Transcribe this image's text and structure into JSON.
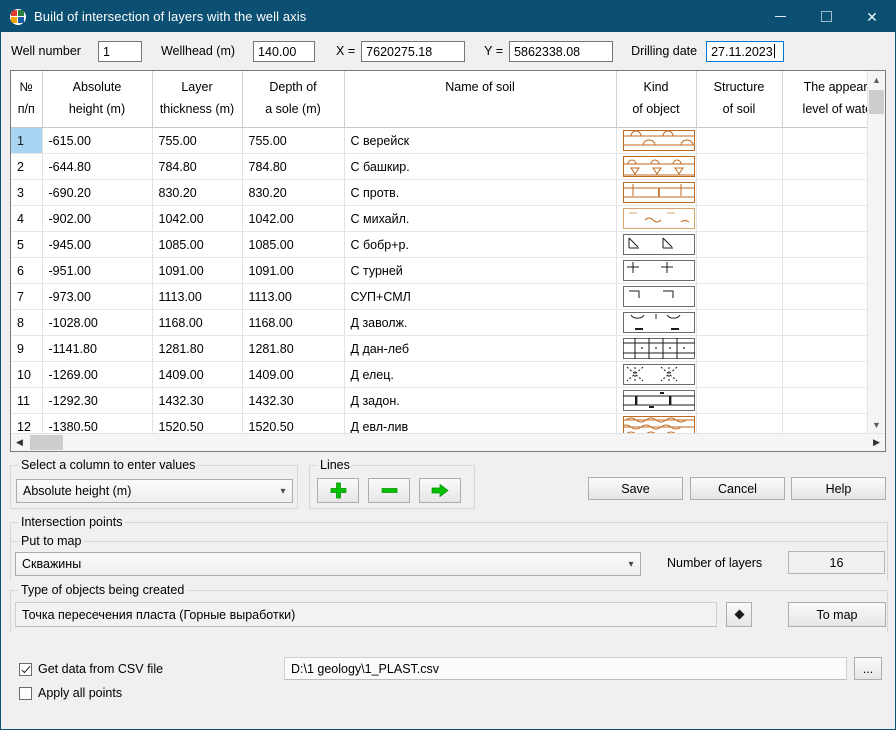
{
  "window": {
    "title": "Build of intersection of layers with the well axis",
    "app_icon": "globe-icon",
    "minimize": "minimize-icon",
    "maximize": "maximize-icon",
    "close": "close-icon"
  },
  "topbar": {
    "well_number_label": "Well number",
    "well_number_value": "1",
    "wellhead_label": "Wellhead (m)",
    "wellhead_value": "140.00",
    "x_label": "X =",
    "x_value": "7620275.18",
    "y_label": "Y =",
    "y_value": "5862338.08",
    "drilling_date_label": "Drilling date",
    "drilling_date_value": "27.11.2023"
  },
  "table": {
    "columns": [
      {
        "line1": "№",
        "line2": "п/п"
      },
      {
        "line1": "Absolute",
        "line2": "height (m)"
      },
      {
        "line1": "Layer",
        "line2": "thickness (m)"
      },
      {
        "line1": "Depth of",
        "line2": "a sole (m)"
      },
      {
        "line1": "Name of soil",
        "line2": ""
      },
      {
        "line1": "Kind",
        "line2": "of object"
      },
      {
        "line1": "Structure",
        "line2": "of soil"
      },
      {
        "line1": "The appeared",
        "line2": "level of waters"
      }
    ],
    "selected_row": 1,
    "rows": [
      {
        "n": "1",
        "abs": "-615.00",
        "thk": "755.00",
        "dep": "755.00",
        "name": "С верейск",
        "kind": "pattern-limestone-arcs",
        "structure": "",
        "water": ""
      },
      {
        "n": "2",
        "abs": "-644.80",
        "thk": "784.80",
        "dep": "784.80",
        "name": "С башкир.",
        "kind": "pattern-fossil-shells",
        "structure": "",
        "water": ""
      },
      {
        "n": "3",
        "abs": "-690.20",
        "thk": "830.20",
        "dep": "830.20",
        "name": "С протв.",
        "kind": "pattern-bedded-vertical",
        "structure": "",
        "water": ""
      },
      {
        "n": "4",
        "abs": "-902.00",
        "thk": "1042.00",
        "dep": "1042.00",
        "name": "С михайл.",
        "kind": "pattern-wavy-light",
        "structure": "",
        "water": ""
      },
      {
        "n": "5",
        "abs": "-945.00",
        "thk": "1085.00",
        "dep": "1085.00",
        "name": "С бобр+р.",
        "kind": "pattern-slash-marks",
        "structure": "",
        "water": ""
      },
      {
        "n": "6",
        "abs": "-951.00",
        "thk": "1091.00",
        "dep": "1091.00",
        "name": "С турней",
        "kind": "pattern-cross-marks",
        "structure": "",
        "water": ""
      },
      {
        "n": "7",
        "abs": "-973.00",
        "thk": "1113.00",
        "dep": "1113.00",
        "name": "СУП+СМЛ",
        "kind": "pattern-bracket-marks",
        "structure": "",
        "water": ""
      },
      {
        "n": "8",
        "abs": "-1028.00",
        "thk": "1168.00",
        "dep": "1168.00",
        "name": "Д заволж.",
        "kind": "pattern-arc-dashes",
        "structure": "",
        "water": ""
      },
      {
        "n": "9",
        "abs": "-1141.80",
        "thk": "1281.80",
        "dep": "1281.80",
        "name": "Д дан-леб",
        "kind": "pattern-brick-dotted",
        "structure": "",
        "water": ""
      },
      {
        "n": "10",
        "abs": "-1269.00",
        "thk": "1409.00",
        "dep": "1409.00",
        "name": "Д елец.",
        "kind": "pattern-crosshatch-dots",
        "structure": "",
        "water": ""
      },
      {
        "n": "11",
        "abs": "-1292.30",
        "thk": "1432.30",
        "dep": "1432.30",
        "name": "Д задон.",
        "kind": "pattern-bedded-solid",
        "structure": "",
        "water": ""
      },
      {
        "n": "12",
        "abs": "-1380.50",
        "thk": "1520.50",
        "dep": "1520.50",
        "name": "Д евл-лив",
        "kind": "pattern-dolomite-orange",
        "structure": "",
        "water": ""
      }
    ]
  },
  "column_group": {
    "title": "Select a column to enter values",
    "selected": "Absolute height (m)"
  },
  "lines_group": {
    "title": "Lines",
    "add": "plus-icon",
    "remove": "minus-icon",
    "move": "arrow-right-icon"
  },
  "actions": {
    "save": "Save",
    "cancel": "Cancel",
    "help": "Help"
  },
  "intersection": {
    "title": "Intersection points",
    "put_to_map_title": "Put to map",
    "put_to_map_value": "Скважины",
    "number_of_layers_label": "Number of layers",
    "number_of_layers_value": "16"
  },
  "object_type": {
    "title": "Type of objects being created",
    "value": "Точка пересечения пласта (Горные выработки)",
    "symbol_button": "diamond-icon",
    "to_map": "To map"
  },
  "csv": {
    "get_data_label": "Get data from CSV file",
    "get_data_checked": true,
    "path": "D:\\1 geology\\1_PLAST.csv",
    "browse": "...",
    "apply_all_label": "Apply all points",
    "apply_all_checked": false
  },
  "colors": {
    "titlebar": "#0b4f72",
    "selection": "#a8d4f2",
    "accent_green": "#00c000",
    "pattern_orange": "#c06a20"
  }
}
